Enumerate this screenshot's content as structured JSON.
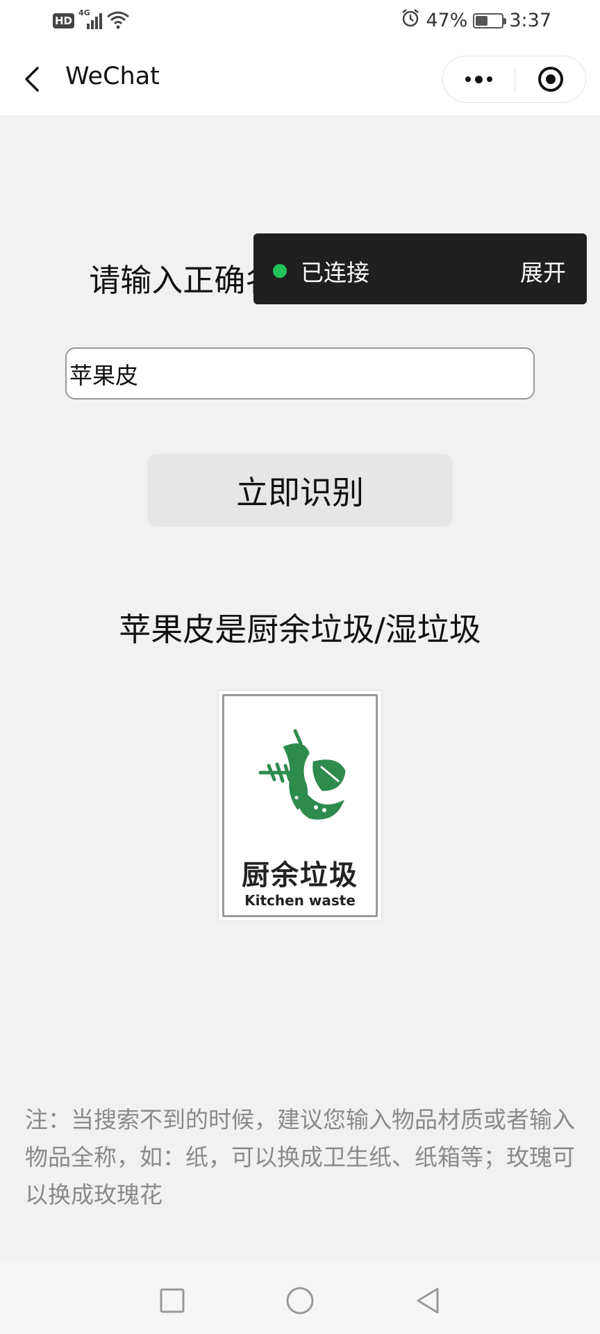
{
  "status_bar": {
    "hd_badge": "HD",
    "network": "4G",
    "battery_percent": "47%",
    "battery_level": 0.47,
    "time": "3:37"
  },
  "nav": {
    "title": "WeChat"
  },
  "prompt": {
    "label": "请输入正确名称（包含材质）："
  },
  "toast": {
    "text": "已连接",
    "expand": "展开",
    "dot_color": "#21c35a"
  },
  "search": {
    "value": "苹果皮"
  },
  "identify_button": {
    "label": "立即识别"
  },
  "result": {
    "text": "苹果皮是厨余垃圾/湿垃圾"
  },
  "waste_card": {
    "name_cn": "厨余垃圾",
    "name_en": "Kitchen waste",
    "icon_color": "#2e8b4e"
  },
  "note": {
    "text": "注：当搜索不到的时候，建议您输入物品材质或者输入物品全称，如：纸，可以换成卫生纸、纸箱等；玫瑰可以换成玫瑰花"
  }
}
